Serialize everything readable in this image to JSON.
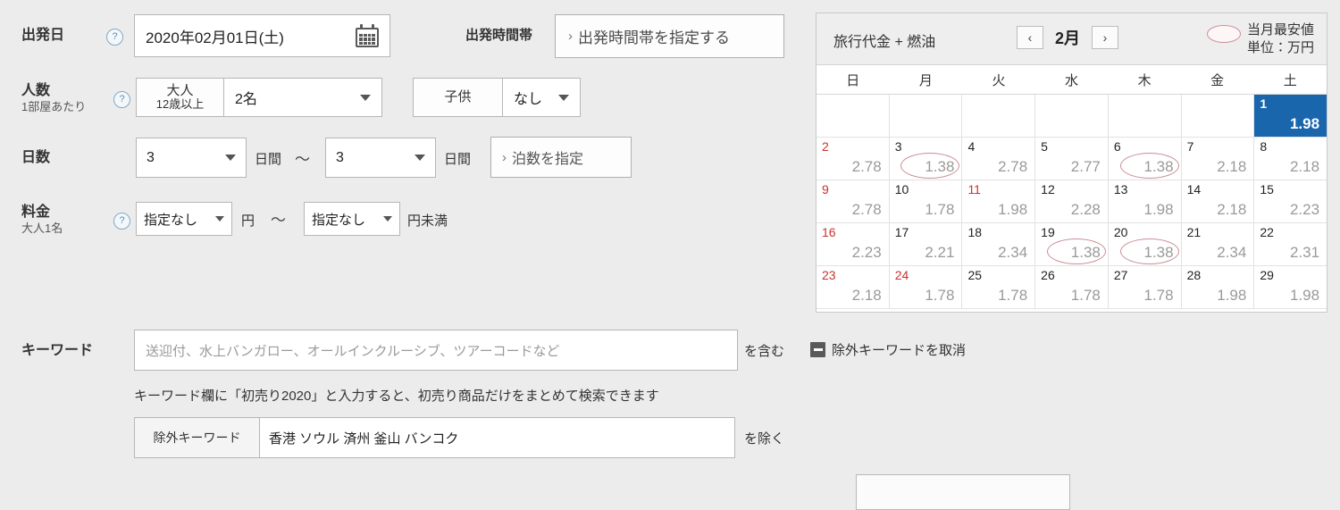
{
  "form": {
    "departure_date": {
      "label": "出発日",
      "help_icon": "question-mark-icon",
      "value": "2020年02月01日(土)",
      "calendar_icon": "calendar-icon"
    },
    "departure_time": {
      "label": "出発時間帯",
      "button_label": "出発時間帯を指定する",
      "chevron": "›"
    },
    "people": {
      "label": "人数",
      "sublabel": "1部屋あたり",
      "help_icon": "question-mark-icon",
      "adult": {
        "tag_line1": "大人",
        "tag_line2": "12歳以上",
        "value": "2名"
      },
      "child": {
        "tag": "子供",
        "value": "なし"
      }
    },
    "days": {
      "label": "日数",
      "from_value": "3",
      "from_unit": "日間",
      "separator": "〜",
      "to_value": "3",
      "to_unit": "日間",
      "nights_button": "泊数を指定",
      "nights_chevron": "›"
    },
    "price": {
      "label": "料金",
      "sublabel": "大人1名",
      "help_icon": "question-mark-icon",
      "from_value": "指定なし",
      "from_unit": "円",
      "separator": "〜",
      "to_value": "指定なし",
      "to_unit": "円未満"
    },
    "keyword": {
      "label": "キーワード",
      "placeholder": "送迎付、水上バンガロー、オールインクルーシブ、ツアーコードなど",
      "value": "",
      "suffix": "を含む",
      "toggle_label": "除外キーワードを取消",
      "toggle_icon": "minus-box-icon",
      "hint": "キーワード欄に「初売り2020」と入力すると、初売り商品だけをまとめて検索できます",
      "exclude_tag": "除外キーワード",
      "exclude_value": "香港 ソウル 済州 釜山 バンコク",
      "exclude_suffix": "を除く"
    }
  },
  "calendar": {
    "title": "旅行代金 + 燃油",
    "prev_icon": "chevron-left-icon",
    "next_icon": "chevron-right-icon",
    "month_label": "2月",
    "legend_icon": "red-ellipse-icon",
    "legend_line1": "当月最安値",
    "legend_line2": "単位：万円",
    "weekdays": [
      "日",
      "月",
      "火",
      "水",
      "木",
      "金",
      "土"
    ],
    "selected_color": "#1966ad",
    "cheapest_marker_color": "#c98f96",
    "holiday_color": "#c8332e",
    "weeks": [
      [
        {
          "day": "",
          "price": ""
        },
        {
          "day": "",
          "price": ""
        },
        {
          "day": "",
          "price": ""
        },
        {
          "day": "",
          "price": ""
        },
        {
          "day": "",
          "price": ""
        },
        {
          "day": "",
          "price": ""
        },
        {
          "day": "1",
          "price": "1.98",
          "selected": true
        }
      ],
      [
        {
          "day": "2",
          "price": "2.78",
          "holiday": true
        },
        {
          "day": "3",
          "price": "1.38",
          "cheapest": true
        },
        {
          "day": "4",
          "price": "2.78"
        },
        {
          "day": "5",
          "price": "2.77"
        },
        {
          "day": "6",
          "price": "1.38",
          "cheapest": true
        },
        {
          "day": "7",
          "price": "2.18"
        },
        {
          "day": "8",
          "price": "2.18"
        }
      ],
      [
        {
          "day": "9",
          "price": "2.78",
          "holiday": true
        },
        {
          "day": "10",
          "price": "1.78"
        },
        {
          "day": "11",
          "price": "1.98",
          "holiday": true
        },
        {
          "day": "12",
          "price": "2.28"
        },
        {
          "day": "13",
          "price": "1.98"
        },
        {
          "day": "14",
          "price": "2.18"
        },
        {
          "day": "15",
          "price": "2.23"
        }
      ],
      [
        {
          "day": "16",
          "price": "2.23",
          "holiday": true
        },
        {
          "day": "17",
          "price": "2.21"
        },
        {
          "day": "18",
          "price": "2.34"
        },
        {
          "day": "19",
          "price": "1.38",
          "cheapest": true
        },
        {
          "day": "20",
          "price": "1.38",
          "cheapest": true
        },
        {
          "day": "21",
          "price": "2.34"
        },
        {
          "day": "22",
          "price": "2.31"
        }
      ],
      [
        {
          "day": "23",
          "price": "2.18",
          "holiday": true
        },
        {
          "day": "24",
          "price": "1.78",
          "holiday": true
        },
        {
          "day": "25",
          "price": "1.78"
        },
        {
          "day": "26",
          "price": "1.78"
        },
        {
          "day": "27",
          "price": "1.78"
        },
        {
          "day": "28",
          "price": "1.98"
        },
        {
          "day": "29",
          "price": "1.98"
        }
      ]
    ]
  }
}
